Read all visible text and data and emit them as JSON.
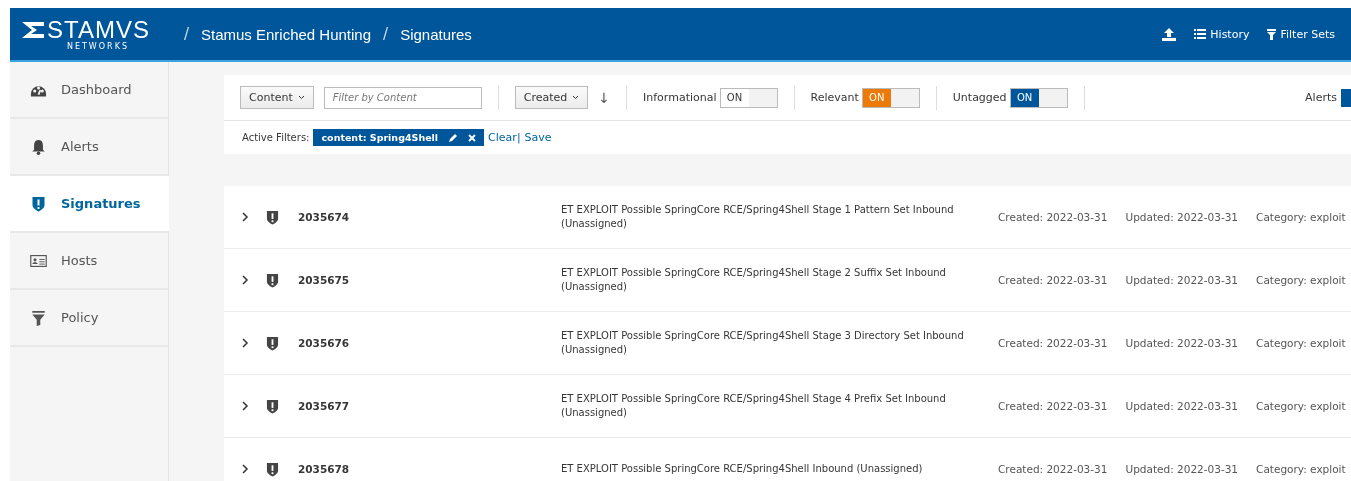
{
  "header": {
    "brand": "STAMVS",
    "brand_sub": "NETWORKS",
    "breadcrumbs": [
      {
        "separator": "/",
        "label": "Stamus Enriched Hunting"
      },
      {
        "separator": "/",
        "label": "Signatures"
      }
    ],
    "actions": [
      {
        "kind": "upload"
      },
      {
        "kind": "history",
        "label": "History"
      },
      {
        "kind": "filter",
        "label": "Filter Sets"
      }
    ]
  },
  "sidebar": {
    "items": [
      {
        "label": "Dashboard",
        "kind": "dashboard",
        "selected": false
      },
      {
        "label": "Alerts",
        "kind": "bell",
        "selected": false
      },
      {
        "label": "Signatures",
        "kind": "shield",
        "selected": true
      },
      {
        "label": "Hosts",
        "kind": "card",
        "selected": false
      },
      {
        "label": "Policy",
        "kind": "funnel",
        "selected": false
      }
    ]
  },
  "toolbar": {
    "filter_type": "Content",
    "filter_placeholder": "Filter by Content",
    "sort": "Created",
    "sort_icon": "↓",
    "toggles": [
      {
        "label": "Informational",
        "on_label": "ON",
        "on": false,
        "color": "#ffffff"
      },
      {
        "label": "Relevant",
        "on_label": "ON",
        "on": true,
        "color": "#ec7a08"
      },
      {
        "label": "Untagged",
        "on_label": "ON",
        "on": true,
        "color": "#00569a"
      }
    ],
    "alerts": {
      "label": "Alerts",
      "on": true
    }
  },
  "active_filters": {
    "label": "Active Filters:",
    "chips": [
      {
        "text": "content: Spring4Shell"
      }
    ],
    "clear": "Clear|",
    "save": "Save"
  },
  "rows": [
    {
      "id": "2035674",
      "message": "ET EXPLOIT Possible SpringCore RCE/Spring4Shell Stage 1 Pattern Set Inbound (Unassigned)",
      "created": "Created: 2022-03-31",
      "updated": "Updated: 2022-03-31",
      "category": "Category: exploit"
    },
    {
      "id": "2035675",
      "message": "ET EXPLOIT Possible SpringCore RCE/Spring4Shell Stage 2 Suffix Set Inbound (Unassigned)",
      "created": "Created: 2022-03-31",
      "updated": "Updated: 2022-03-31",
      "category": "Category: exploit"
    },
    {
      "id": "2035676",
      "message": "ET EXPLOIT Possible SpringCore RCE/Spring4Shell Stage 3 Directory Set Inbound (Unassigned)",
      "created": "Created: 2022-03-31",
      "updated": "Updated: 2022-03-31",
      "category": "Category: exploit"
    },
    {
      "id": "2035677",
      "message": "ET EXPLOIT Possible SpringCore RCE/Spring4Shell Stage 4 Prefix Set Inbound (Unassigned)",
      "created": "Created: 2022-03-31",
      "updated": "Updated: 2022-03-31",
      "category": "Category: exploit"
    },
    {
      "id": "2035678",
      "message": "ET EXPLOIT Possible SpringCore RCE/Spring4Shell Inbound (Unassigned)",
      "created": "Created: 2022-03-31",
      "updated": "Updated: 2022-03-31",
      "category": "Category: exploit"
    }
  ]
}
